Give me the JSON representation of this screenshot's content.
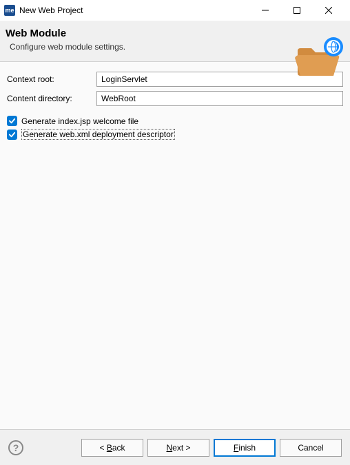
{
  "window": {
    "app_badge": "me",
    "title": "New Web Project"
  },
  "header": {
    "title": "Web Module",
    "subtitle": "Configure web module settings."
  },
  "form": {
    "context_root_label": "Context root:",
    "context_root_value": "LoginServlet",
    "content_dir_label": "Content directory:",
    "content_dir_value": "WebRoot"
  },
  "checkboxes": {
    "generate_jsp": {
      "checked": true,
      "label": "Generate index.jsp welcome file"
    },
    "generate_webxml": {
      "checked": true,
      "label": "Generate web.xml deployment descriptor"
    }
  },
  "footer": {
    "back": "ack",
    "next": "ext >",
    "finish": "inish",
    "cancel": "Cancel"
  }
}
